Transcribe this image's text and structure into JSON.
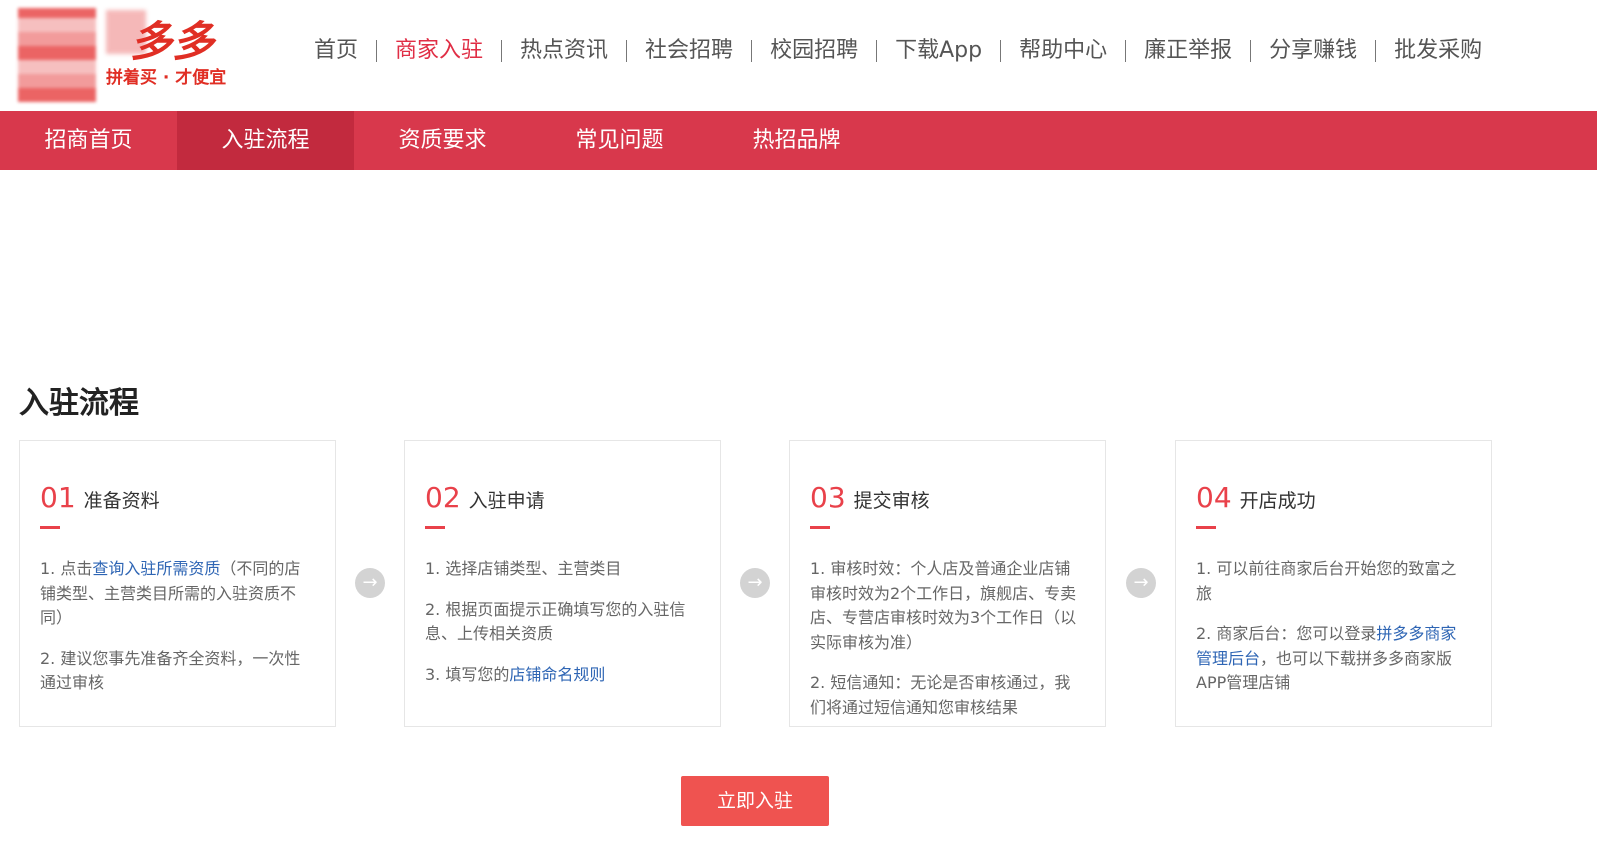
{
  "header": {
    "logo_text": "多多",
    "logo_slogan": "拼着买 · 才便宜",
    "nav": [
      {
        "label": "首页",
        "active": false
      },
      {
        "label": "商家入驻",
        "active": true
      },
      {
        "label": "热点资讯",
        "active": false
      },
      {
        "label": "社会招聘",
        "active": false
      },
      {
        "label": "校园招聘",
        "active": false
      },
      {
        "label": "下载App",
        "active": false
      },
      {
        "label": "帮助中心",
        "active": false
      },
      {
        "label": "廉正举报",
        "active": false
      },
      {
        "label": "分享赚钱",
        "active": false
      },
      {
        "label": "批发采购",
        "active": false
      }
    ]
  },
  "subnav": {
    "tabs": [
      {
        "label": "招商首页",
        "active": false
      },
      {
        "label": "入驻流程",
        "active": true
      },
      {
        "label": "资质要求",
        "active": false
      },
      {
        "label": "常见问题",
        "active": false
      },
      {
        "label": "热招品牌",
        "active": false
      }
    ]
  },
  "section": {
    "title": "入驻流程",
    "steps": [
      {
        "num": "01",
        "title": "准备资料",
        "items": [
          {
            "pre": "1. 点击",
            "link": "查询入驻所需资质",
            "post": "（不同的店铺类型、主营类目所需的入驻资质不同）"
          },
          {
            "pre": "2. 建议您事先准备齐全资料，一次性通过审核",
            "link": "",
            "post": ""
          }
        ]
      },
      {
        "num": "02",
        "title": "入驻申请",
        "items": [
          {
            "pre": "1. 选择店铺类型、主营类目",
            "link": "",
            "post": ""
          },
          {
            "pre": "2. 根据页面提示正确填写您的入驻信息、上传相关资质",
            "link": "",
            "post": ""
          },
          {
            "pre": "3. 填写您的",
            "link": "店铺命名规则",
            "post": ""
          }
        ]
      },
      {
        "num": "03",
        "title": "提交审核",
        "items": [
          {
            "pre": "1. 审核时效：个人店及普通企业店铺审核时效为2个工作日，旗舰店、专卖店、专营店审核时效为3个工作日（以实际审核为准）",
            "link": "",
            "post": ""
          },
          {
            "pre": "2. 短信通知：无论是否审核通过，我们将通过短信通知您审核结果",
            "link": "",
            "post": ""
          }
        ]
      },
      {
        "num": "04",
        "title": "开店成功",
        "items": [
          {
            "pre": "1. 可以前往商家后台开始您的致富之旅",
            "link": "",
            "post": ""
          },
          {
            "pre": "2. 商家后台：您可以登录",
            "link": "拼多多商家管理后台",
            "post": "，也可以下载拼多多商家版APP管理店铺"
          }
        ]
      }
    ],
    "arrow_icon": "arrow-right-circle-icon",
    "cta_label": "立即入驻"
  },
  "colors": {
    "brand_red": "#d8384c",
    "accent": "#e9414a",
    "link": "#2e65b4",
    "cta": "#ef5350"
  }
}
